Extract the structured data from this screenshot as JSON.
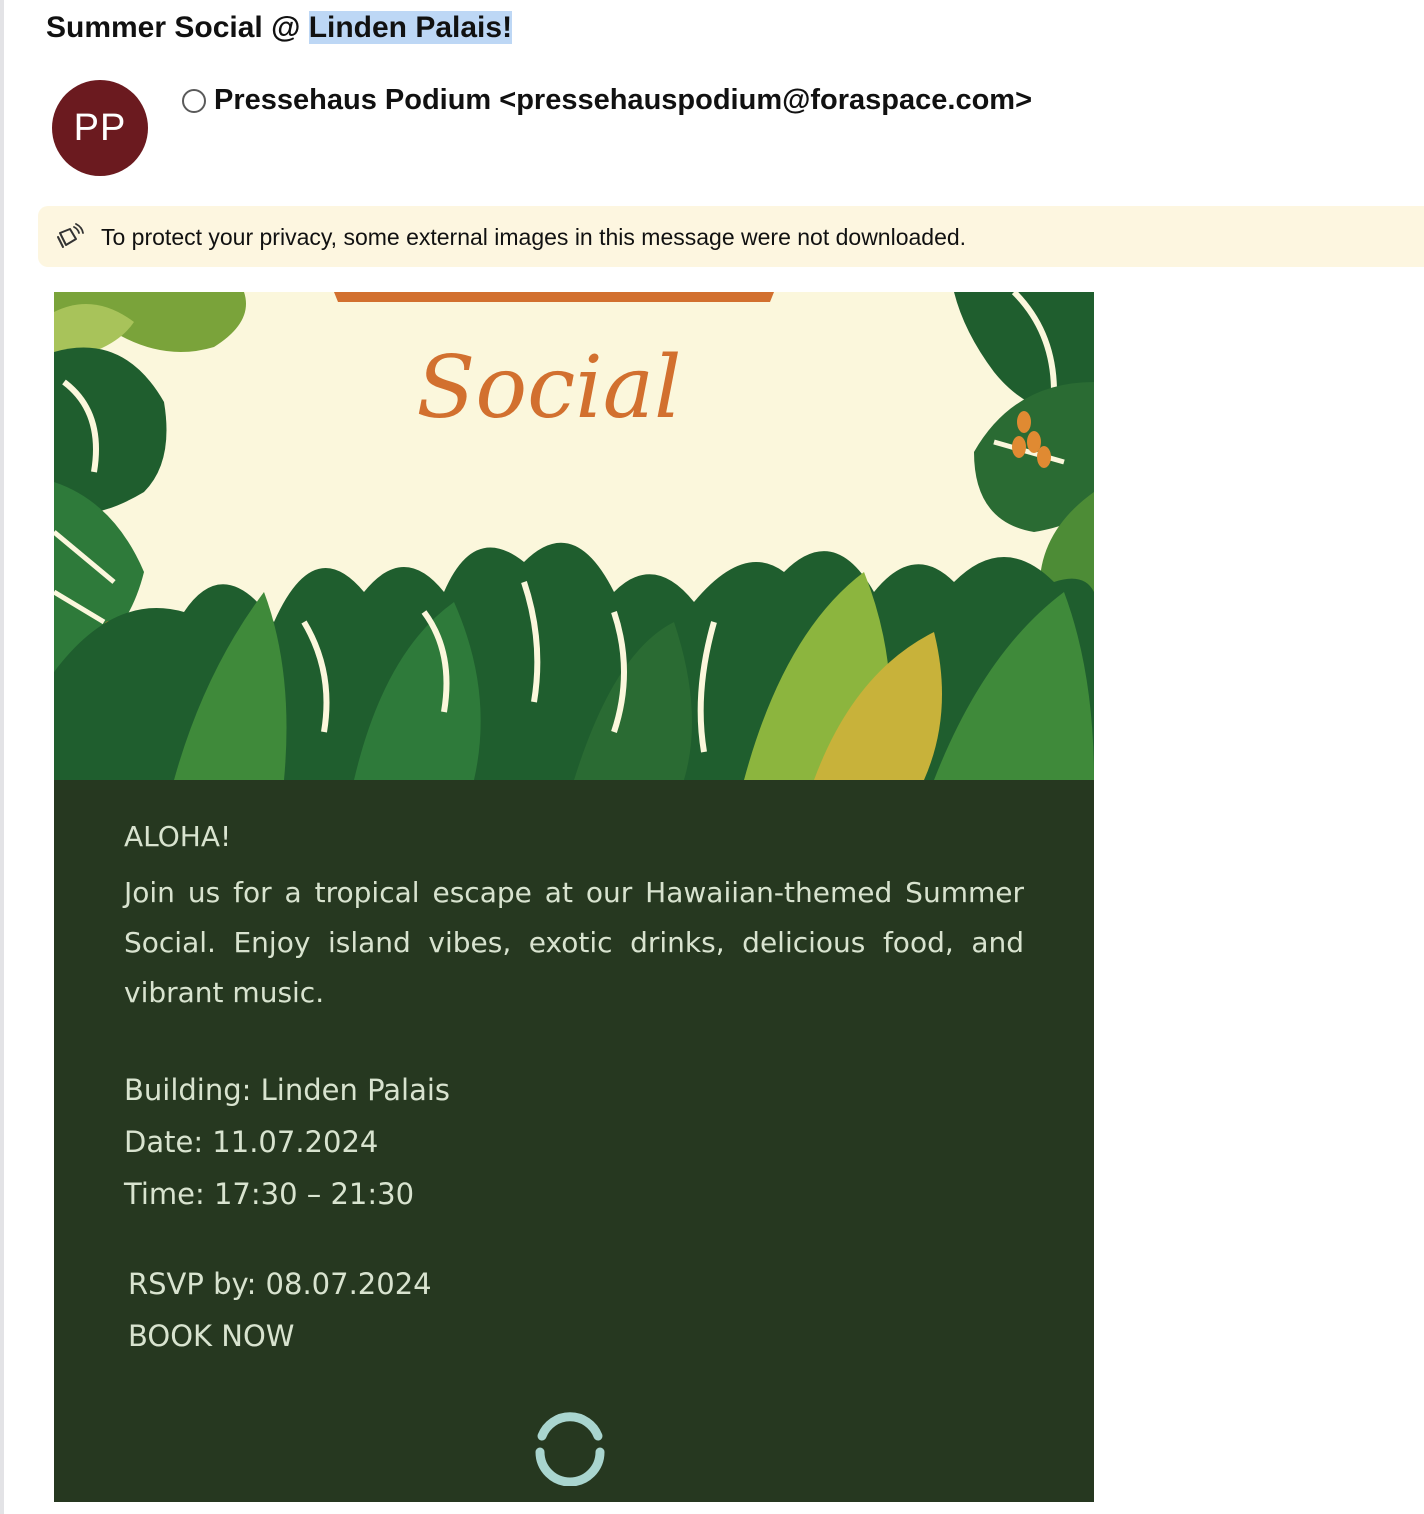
{
  "email": {
    "subject_prefix": "Summer Social @ ",
    "subject_highlight": "Linden Palais!",
    "sender": {
      "initials": "PP",
      "avatar_color": "#6b1a1f",
      "display": "Pressehaus Podium <pressehauspodium@foraspace.com>"
    },
    "privacy_notice": "To protect your privacy, some external images in this message were not downloaded."
  },
  "banner": {
    "title_script": "Social"
  },
  "content": {
    "greeting": "ALOHA!",
    "intro": "Join us for a tropical escape at our Hawaiian-themed Summer Social. Enjoy island vibes, exotic drinks, delicious food, and vibrant music.",
    "building": "Building: Linden Palais",
    "date": "Date: 11.07.2024",
    "time": "Time: 17:30 – 21:30",
    "rsvp": "RSVP by: 08.07.2024",
    "book_now": "BOOK NOW"
  },
  "colors": {
    "panel_bg": "#263820",
    "banner_bg": "#fbf7dc",
    "accent_orange": "#d2702f",
    "highlight": "#bdd7f5"
  }
}
